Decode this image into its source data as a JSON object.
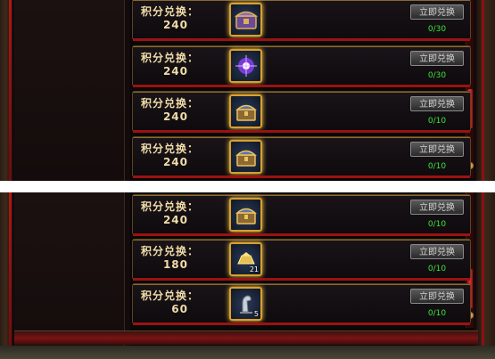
{
  "rows_top": [
    {
      "label": "积分兑换：",
      "points": "240",
      "button": "立即兑换",
      "count": "0/30",
      "icon": "purple-chest-icon"
    },
    {
      "label": "积分兑换：",
      "points": "240",
      "button": "立即兑换",
      "count": "0/30",
      "icon": "violet-orb-icon"
    },
    {
      "label": "积分兑换：",
      "points": "240",
      "button": "立即兑换",
      "count": "0/10",
      "icon": "treasure-chest-icon"
    },
    {
      "label": "积分兑换：",
      "points": "240",
      "button": "立即兑换",
      "count": "0/10",
      "icon": "treasure-chest-icon"
    }
  ],
  "rows_bottom": [
    {
      "label": "积分兑换：",
      "points": "240",
      "button": "立即兑换",
      "count": "0/10",
      "icon": "treasure-chest-icon"
    },
    {
      "label": "积分兑换：",
      "points": "180",
      "button": "立即兑换",
      "count": "0/10",
      "icon": "gold-ingot-icon",
      "stack": "21"
    },
    {
      "label": "积分兑换：",
      "points": "60",
      "button": "立即兑换",
      "count": "0/10",
      "icon": "horse-statue-icon",
      "stack": "5"
    }
  ],
  "colors": {
    "label": "#f0dca8",
    "count": "#38e838",
    "accent_red": "#9b1212",
    "gold_border": "#d8a030"
  }
}
